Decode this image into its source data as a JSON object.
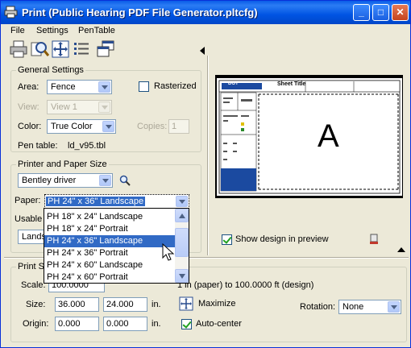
{
  "window": {
    "title": "Print  (Public Hearing PDF File Generator.pltcfg)"
  },
  "menu": [
    "File",
    "Settings",
    "PenTable"
  ],
  "general": {
    "group_label": "General Settings",
    "area_label": "Area:",
    "area_value": "Fence",
    "rasterized_label": "Rasterized",
    "view_label": "View:",
    "view_value": "View 1",
    "color_label": "Color:",
    "color_value": "True Color",
    "copies_label": "Copies:",
    "copies_value": "1",
    "pentable_label": "Pen table:",
    "pentable_value": "ld_v95.tbl"
  },
  "printer": {
    "group_label": "Printer and Paper Size",
    "driver_value": "Bentley driver",
    "paper_label": "Paper:",
    "paper_value": "PH 24\" x 36\" Landscape",
    "usable_label": "Usable",
    "landscape_partial": "Lands",
    "paper_options": [
      "PH 18\" x 24\" Landscape",
      "PH 18\" x 24\" Portrait",
      "PH 24\" x 36\" Landscape",
      "PH 24\" x 36\" Portrait",
      "PH 24\" x 60\" Landscape",
      "PH 24\" x 60\" Portrait"
    ]
  },
  "preview": {
    "sheet_title": "Sheet Title",
    "logo_text": "DOT",
    "big_letter": "A",
    "show_design_label": "Show design in preview"
  },
  "print_scale": {
    "group_label_partial": "Print Sc",
    "scale_label": "Scale:",
    "scale_value": "100.0000",
    "scale_text": "1 in (paper) to 100.0000 ft (design)",
    "size_label": "Size:",
    "size_w": "36.000",
    "size_h": "24.000",
    "unit": "in.",
    "maximize_label": "Maximize",
    "rotation_label": "Rotation:",
    "rotation_value": "None",
    "origin_label": "Origin:",
    "origin_x": "0.000",
    "origin_y": "0.000",
    "autocenter_label": "Auto-center"
  }
}
